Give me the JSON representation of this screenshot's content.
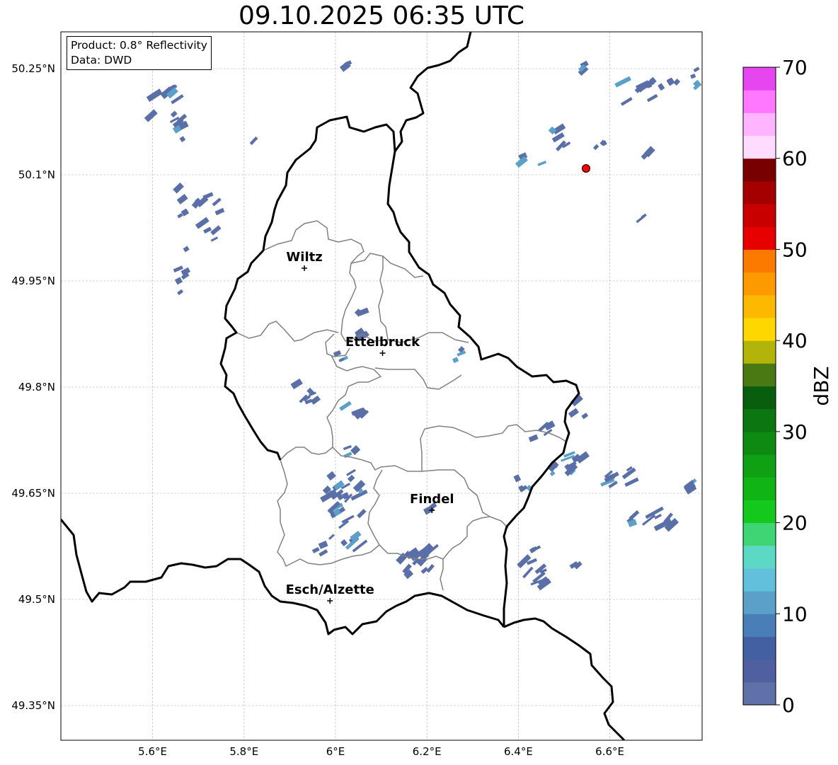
{
  "title": "09.10.2025 06:35 UTC",
  "info": {
    "product": "Product: 0.8° Reflectivity",
    "source": "Data: DWD"
  },
  "axes": {
    "lon_ticks": [
      {
        "value": 5.6,
        "label": "5.6°E"
      },
      {
        "value": 5.8,
        "label": "5.8°E"
      },
      {
        "value": 6.0,
        "label": "6°E"
      },
      {
        "value": 6.2,
        "label": "6.2°E"
      },
      {
        "value": 6.4,
        "label": "6.4°E"
      },
      {
        "value": 6.6,
        "label": "6.6°E"
      }
    ],
    "lat_ticks": [
      {
        "value": 50.25,
        "label": "50.25°N"
      },
      {
        "value": 50.1,
        "label": "50.1°N"
      },
      {
        "value": 49.95,
        "label": "49.95°N"
      },
      {
        "value": 49.8,
        "label": "49.8°N"
      },
      {
        "value": 49.65,
        "label": "49.65°N"
      },
      {
        "value": 49.5,
        "label": "49.5°N"
      },
      {
        "value": 49.35,
        "label": "49.35°N"
      }
    ],
    "lon_range": [
      5.4,
      6.8
    ],
    "lat_range": [
      49.3,
      50.3
    ],
    "grid": true
  },
  "cities": [
    {
      "name": "Wiltz",
      "lon": 5.932,
      "lat": 49.968
    },
    {
      "name": "Ettelbruck",
      "lon": 6.103,
      "lat": 49.848
    },
    {
      "name": "Findel",
      "lon": 6.211,
      "lat": 49.626
    },
    {
      "name": "Esch/Alzette",
      "lon": 5.988,
      "lat": 49.498
    }
  ],
  "radar_site": {
    "lon": 6.548,
    "lat": 50.109,
    "color": "#ff0000"
  },
  "colorbar": {
    "label": "dBZ",
    "min": 0,
    "max": 70,
    "step": 2.5,
    "ticks": [
      {
        "value": 0,
        "label": "0"
      },
      {
        "value": 10,
        "label": "10"
      },
      {
        "value": 20,
        "label": "20"
      },
      {
        "value": 30,
        "label": "30"
      },
      {
        "value": 40,
        "label": "40"
      },
      {
        "value": 50,
        "label": "50"
      },
      {
        "value": 60,
        "label": "60"
      },
      {
        "value": 70,
        "label": "70"
      }
    ],
    "colors": [
      "#6070a8",
      "#505f9f",
      "#4361a2",
      "#4a7eb6",
      "#5aa0c8",
      "#62c0dc",
      "#5dd8c4",
      "#3fd474",
      "#14c81e",
      "#10b414",
      "#10a014",
      "#0e8a12",
      "#0c7610",
      "#085e0c",
      "#4a7812",
      "#b2b40a",
      "#ffd700",
      "#fcb900",
      "#fc9a00",
      "#fc7a00",
      "#e60000",
      "#c80000",
      "#a50000",
      "#780000",
      "#ffdcff",
      "#ffb4ff",
      "#ff78ff",
      "#e646f0"
    ]
  },
  "echo_colors": {
    "main": "#5a6fa8",
    "light": "#5aa0c8"
  },
  "echoes": [
    {
      "lon": 5.62,
      "lat": 50.205,
      "dlon": 0.045,
      "dlat": 0.035,
      "n": 8
    },
    {
      "lon": 5.66,
      "lat": 50.16,
      "dlon": 0.03,
      "dlat": 0.03,
      "n": 6
    },
    {
      "lon": 5.68,
      "lat": 50.07,
      "dlon": 0.03,
      "dlat": 0.04,
      "n": 6
    },
    {
      "lon": 5.73,
      "lat": 50.035,
      "dlon": 0.035,
      "dlat": 0.045,
      "n": 8
    },
    {
      "lon": 5.665,
      "lat": 49.965,
      "dlon": 0.02,
      "dlat": 0.04,
      "n": 6
    },
    {
      "lon": 6.02,
      "lat": 50.25,
      "dlon": 0.01,
      "dlat": 0.01,
      "n": 3
    },
    {
      "lon": 6.06,
      "lat": 49.89,
      "dlon": 0.02,
      "dlat": 0.025,
      "n": 6
    },
    {
      "lon": 6.01,
      "lat": 49.845,
      "dlon": 0.015,
      "dlat": 0.01,
      "n": 3
    },
    {
      "lon": 5.93,
      "lat": 49.79,
      "dlon": 0.035,
      "dlat": 0.03,
      "n": 7
    },
    {
      "lon": 6.04,
      "lat": 49.765,
      "dlon": 0.03,
      "dlat": 0.015,
      "n": 4
    },
    {
      "lon": 6.03,
      "lat": 49.71,
      "dlon": 0.02,
      "dlat": 0.01,
      "n": 3
    },
    {
      "lon": 6.02,
      "lat": 49.62,
      "dlon": 0.05,
      "dlat": 0.06,
      "n": 22
    },
    {
      "lon": 6.015,
      "lat": 49.66,
      "dlon": 0.035,
      "dlat": 0.025,
      "n": 8
    },
    {
      "lon": 6.18,
      "lat": 49.55,
      "dlon": 0.045,
      "dlat": 0.025,
      "n": 14
    },
    {
      "lon": 6.21,
      "lat": 49.628,
      "dlon": 0.01,
      "dlat": 0.006,
      "n": 2
    },
    {
      "lon": 5.965,
      "lat": 49.57,
      "dlon": 0.012,
      "dlat": 0.01,
      "n": 3
    },
    {
      "lon": 6.43,
      "lat": 49.535,
      "dlon": 0.04,
      "dlat": 0.025,
      "n": 9
    },
    {
      "lon": 6.44,
      "lat": 49.575,
      "dlon": 0.025,
      "dlat": 0.01,
      "n": 3
    },
    {
      "lon": 6.51,
      "lat": 49.69,
      "dlon": 0.05,
      "dlat": 0.02,
      "n": 12
    },
    {
      "lon": 6.62,
      "lat": 49.675,
      "dlon": 0.04,
      "dlat": 0.02,
      "n": 8
    },
    {
      "lon": 6.69,
      "lat": 49.62,
      "dlon": 0.06,
      "dlat": 0.02,
      "n": 10
    },
    {
      "lon": 6.77,
      "lat": 49.66,
      "dlon": 0.025,
      "dlat": 0.008,
      "n": 4
    },
    {
      "lon": 6.41,
      "lat": 49.66,
      "dlon": 0.02,
      "dlat": 0.015,
      "n": 4
    },
    {
      "lon": 6.53,
      "lat": 49.55,
      "dlon": 0.012,
      "dlat": 0.006,
      "n": 2
    },
    {
      "lon": 6.66,
      "lat": 50.225,
      "dlon": 0.05,
      "dlat": 0.03,
      "n": 10
    },
    {
      "lon": 6.72,
      "lat": 50.23,
      "dlon": 0.04,
      "dlat": 0.01,
      "n": 4
    },
    {
      "lon": 6.79,
      "lat": 50.24,
      "dlon": 0.01,
      "dlat": 0.02,
      "n": 4
    },
    {
      "lon": 6.68,
      "lat": 50.13,
      "dlon": 0.01,
      "dlat": 0.008,
      "n": 2
    },
    {
      "lon": 6.67,
      "lat": 50.04,
      "dlon": 0.01,
      "dlat": 0.008,
      "n": 2
    },
    {
      "lon": 6.49,
      "lat": 50.16,
      "dlon": 0.03,
      "dlat": 0.03,
      "n": 5
    },
    {
      "lon": 6.58,
      "lat": 50.14,
      "dlon": 0.015,
      "dlat": 0.02,
      "n": 3
    },
    {
      "lon": 6.43,
      "lat": 50.12,
      "dlon": 0.03,
      "dlat": 0.01,
      "n": 3
    },
    {
      "lon": 6.55,
      "lat": 50.245,
      "dlon": 0.02,
      "dlat": 0.015,
      "n": 3
    },
    {
      "lon": 6.45,
      "lat": 49.73,
      "dlon": 0.03,
      "dlat": 0.02,
      "n": 4
    },
    {
      "lon": 6.53,
      "lat": 49.77,
      "dlon": 0.03,
      "dlat": 0.015,
      "n": 3
    },
    {
      "lon": 6.27,
      "lat": 49.845,
      "dlon": 0.01,
      "dlat": 0.015,
      "n": 3
    },
    {
      "lon": 5.825,
      "lat": 50.15,
      "dlon": 0.005,
      "dlat": 0.005,
      "n": 1
    }
  ]
}
